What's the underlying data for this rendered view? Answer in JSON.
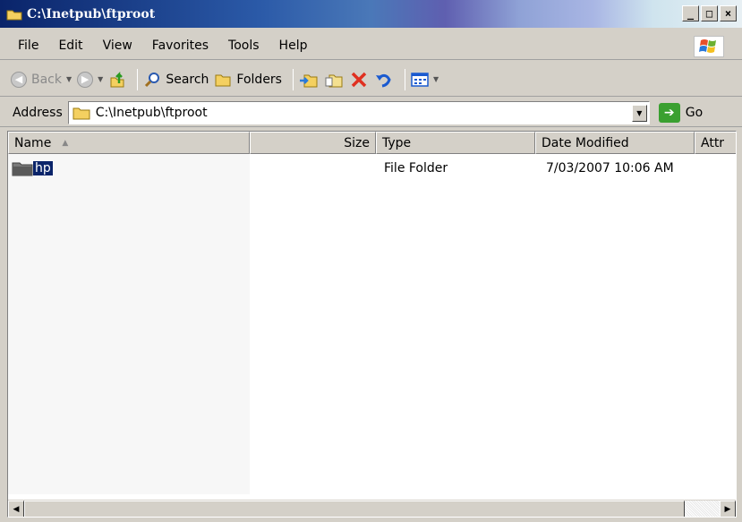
{
  "window": {
    "title": "C:\\Inetpub\\ftproot"
  },
  "menu": {
    "items": [
      "File",
      "Edit",
      "View",
      "Favorites",
      "Tools",
      "Help"
    ]
  },
  "toolbar": {
    "back_label": "Back",
    "search_label": "Search",
    "folders_label": "Folders"
  },
  "address": {
    "label": "Address",
    "value": "C:\\Inetpub\\ftproot",
    "go_label": "Go"
  },
  "columns": {
    "name": "Name",
    "size": "Size",
    "type": "Type",
    "date_modified": "Date Modified",
    "attributes": "Attr"
  },
  "files": [
    {
      "name": "hp",
      "size": "",
      "type": "File Folder",
      "date_modified": "7/03/2007 10:06 AM"
    }
  ],
  "colors": {
    "selection": "#0a246a",
    "folder": "#f0c040",
    "delete": "#e03020"
  }
}
